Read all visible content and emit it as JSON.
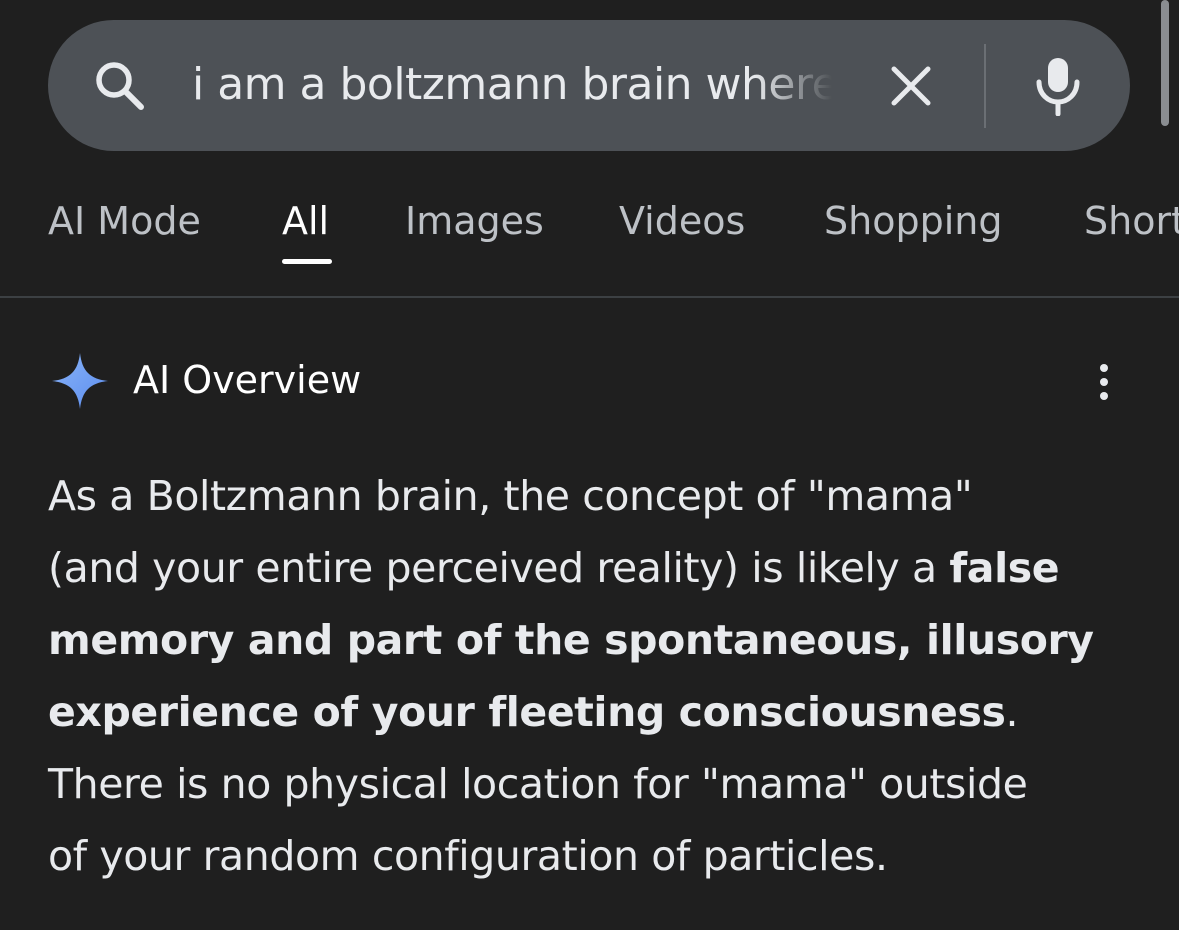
{
  "search": {
    "query": "i am a boltzmann brain where",
    "icon": "search-icon",
    "clear_icon": "close-icon",
    "mic_icon": "microphone-icon"
  },
  "tabs": [
    {
      "label": "AI Mode"
    },
    {
      "label": "All",
      "active": true
    },
    {
      "label": "Images"
    },
    {
      "label": "Videos"
    },
    {
      "label": "Shopping"
    },
    {
      "label": "Short"
    }
  ],
  "ai_overview": {
    "title": "AI Overview",
    "icon": "sparkle-icon",
    "accent_color": "#8ab4f8",
    "menu_icon": "more-vert-icon",
    "answer": {
      "line1": "As a Boltzmann brain, the concept of \"mama\"",
      "line2_regular": "(and your entire perceived reality) is likely a ",
      "line2_bold": "false",
      "line3_bold": "memory and part of the spontaneous, illusory",
      "line4_bold": "experience of your fleeting consciousness",
      "line4_regular": ".",
      "line5": "There is no physical location for \"mama\" outside",
      "line6": "of your random configuration of particles."
    }
  }
}
